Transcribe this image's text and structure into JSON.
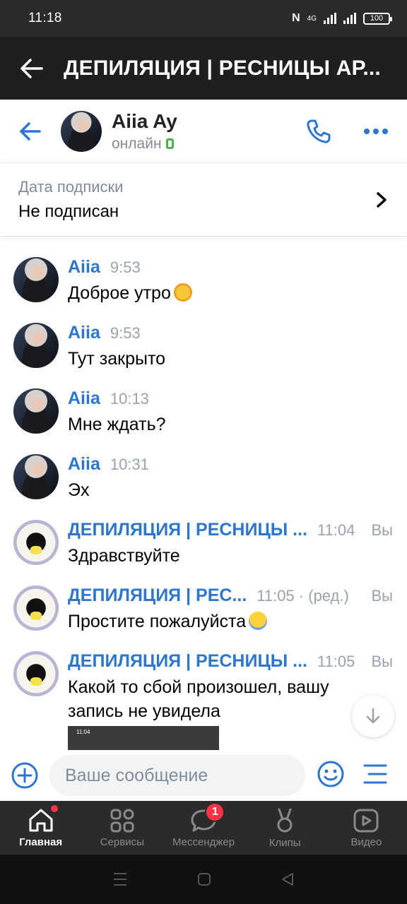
{
  "status_bar": {
    "time": "11:18",
    "network": "4G",
    "battery": "100"
  },
  "group_header": {
    "title": "ДЕПИЛЯЦИЯ | РЕСНИЦЫ АР..."
  },
  "chat_header": {
    "name": "Aiia Ay",
    "status": "онлайн"
  },
  "subscription": {
    "label": "Дата подписки",
    "value": "Не подписан"
  },
  "messages": [
    {
      "author": "Aiia",
      "time": "9:53",
      "text": "Доброе утро",
      "emoji": "sun",
      "own": ""
    },
    {
      "author": "Aiia",
      "time": "9:53",
      "text": "Тут закрыто",
      "own": ""
    },
    {
      "author": "Aiia",
      "time": "10:13",
      "text": "Мне ждать?",
      "own": ""
    },
    {
      "author": "Aiia",
      "time": "10:31",
      "text": "Эх",
      "own": ""
    },
    {
      "author": "ДЕПИЛЯЦИЯ | РЕСНИЦЫ ...",
      "time": "11:04",
      "text": "Здравствуйте",
      "own": "Вы"
    },
    {
      "author": "ДЕПИЛЯЦИЯ | РЕС...",
      "time": "11:05 · (ред.)",
      "text": "Простите пожалуйста",
      "emoji": "scream",
      "own": "Вы"
    },
    {
      "author": "ДЕПИЛЯЦИЯ | РЕСНИЦЫ ...",
      "time": "11:05",
      "text": "Какой то сбой произошел, вашу запись не увидела",
      "own": "Вы"
    }
  ],
  "attachment_preview": {
    "time": "11:04"
  },
  "composer": {
    "placeholder": "Ваше сообщение"
  },
  "bottom_nav": [
    {
      "label": "Главная",
      "icon": "home-icon",
      "active": true
    },
    {
      "label": "Сервисы",
      "icon": "services-icon"
    },
    {
      "label": "Мессенджер",
      "icon": "messenger-icon",
      "badge": "1"
    },
    {
      "label": "Клипы",
      "icon": "clips-icon"
    },
    {
      "label": "Видео",
      "icon": "video-icon"
    }
  ],
  "colors": {
    "accent": "#2a76d2",
    "online": "#4bb34b",
    "badge": "#ff3347"
  }
}
